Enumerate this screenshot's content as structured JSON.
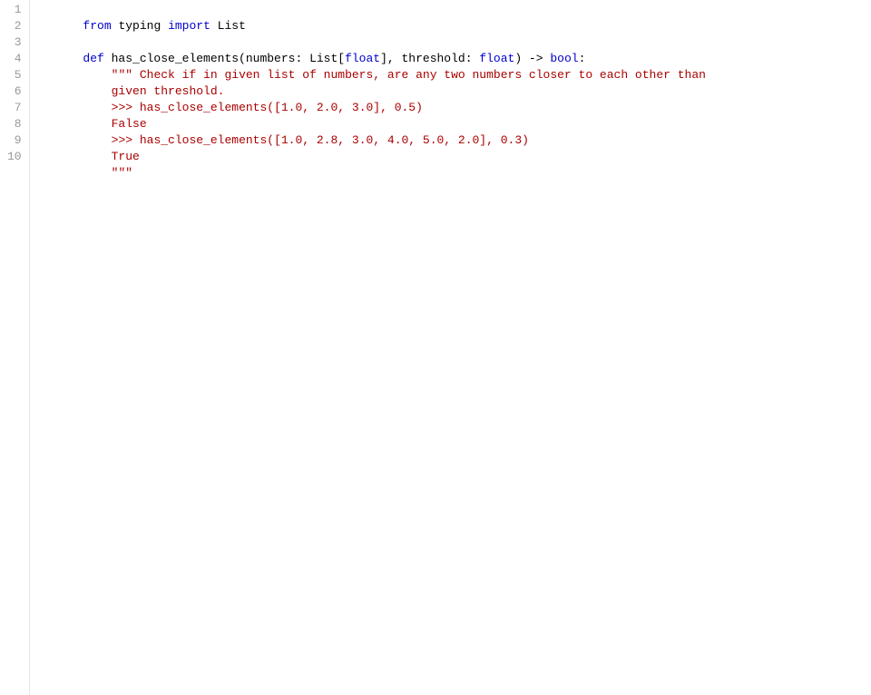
{
  "editor": {
    "lines": [
      {
        "num": 1,
        "tokens": [
          {
            "type": "keyword",
            "text": "from"
          },
          {
            "type": "plain",
            "text": " typing "
          },
          {
            "type": "keyword",
            "text": "import"
          },
          {
            "type": "plain",
            "text": " List"
          }
        ]
      },
      {
        "num": 2,
        "tokens": []
      },
      {
        "num": 3,
        "tokens": [
          {
            "type": "keyword",
            "text": "def"
          },
          {
            "type": "plain",
            "text": " has_close_elements(numbers: List["
          },
          {
            "type": "keyword",
            "text": "float"
          },
          {
            "type": "plain",
            "text": "], threshold: "
          },
          {
            "type": "keyword",
            "text": "float"
          },
          {
            "type": "plain",
            "text": ") -> "
          },
          {
            "type": "keyword",
            "text": "bool"
          },
          {
            "type": "plain",
            "text": ":"
          }
        ]
      },
      {
        "num": 4,
        "tokens": [
          {
            "type": "plain",
            "text": "    "
          },
          {
            "type": "docstring",
            "text": "\"\"\" Check if in given list of numbers, are any two numbers closer to each other than"
          }
        ]
      },
      {
        "num": 5,
        "tokens": [
          {
            "type": "docstring",
            "text": "    given threshold."
          }
        ]
      },
      {
        "num": 6,
        "tokens": [
          {
            "type": "plain",
            "text": "    "
          },
          {
            "type": "prompt",
            "text": ">>>"
          },
          {
            "type": "docstring",
            "text": " has_close_elements([1.0, 2.0, 3.0], 0.5)"
          }
        ]
      },
      {
        "num": 7,
        "tokens": [
          {
            "type": "docstring",
            "text": "    False"
          }
        ]
      },
      {
        "num": 8,
        "tokens": [
          {
            "type": "plain",
            "text": "    "
          },
          {
            "type": "prompt",
            "text": ">>>"
          },
          {
            "type": "docstring",
            "text": " has_close_elements([1.0, 2.8, 3.0, 4.0, 5.0, 2.0], 0.3)"
          }
        ]
      },
      {
        "num": 9,
        "tokens": [
          {
            "type": "docstring",
            "text": "    True"
          }
        ]
      },
      {
        "num": 10,
        "tokens": [
          {
            "type": "plain",
            "text": "    "
          },
          {
            "type": "docstring",
            "text": "\"\"\""
          }
        ]
      }
    ]
  }
}
